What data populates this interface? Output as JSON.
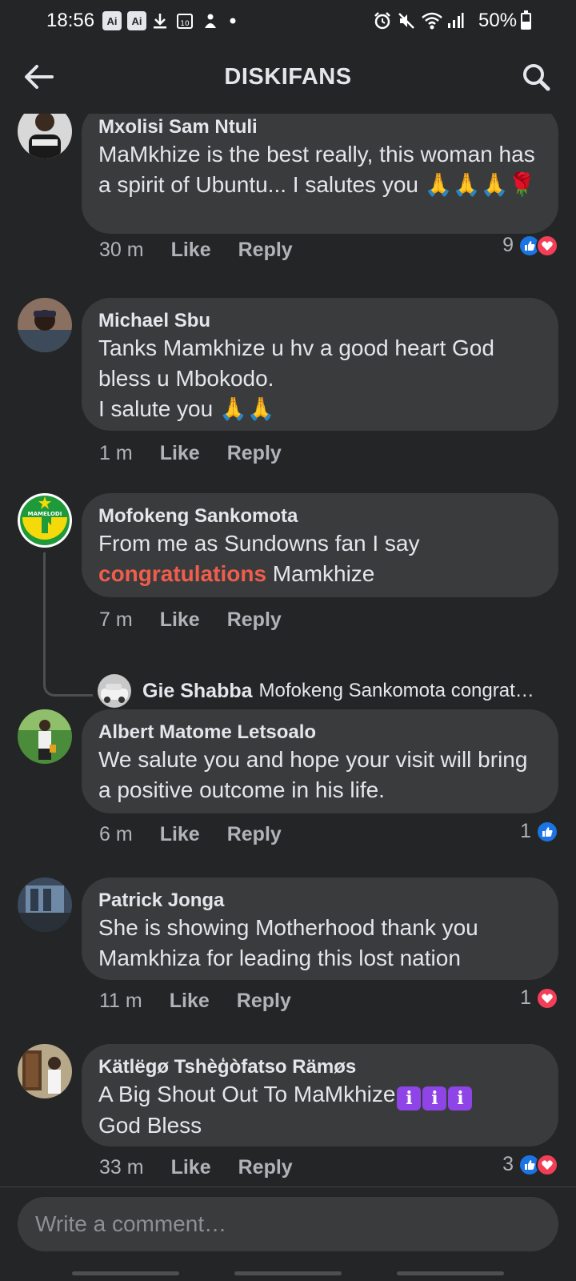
{
  "status_bar": {
    "time": "18:56",
    "icons": [
      "ai-notification-icon",
      "ai-notification-icon",
      "download-icon",
      "calendar-icon",
      "game-icon",
      "dot-icon",
      "alarm-icon",
      "mute-icon",
      "wifi-icon",
      "signal-icon"
    ],
    "ai_label": "Ai",
    "calendar_label": "10",
    "battery_text": "50%",
    "battery_level": 0.5
  },
  "app_bar": {
    "title": "DISKIFANS"
  },
  "comments": [
    {
      "author": "Mxolisi Sam Ntuli",
      "text": "MaMkhize is the best really, this woman has a spirit of Ubuntu... I salutes you 🙏🙏🙏🌹",
      "time": "30 m",
      "like_label": "Like",
      "reply_label": "Reply",
      "reaction_count": "9",
      "reactions": [
        "like",
        "love"
      ]
    },
    {
      "author": "Michael Sbu",
      "text_lines": [
        "Tanks Mamkhize u hv a good heart God bless u Mbokodo.",
        "I salute you 🙏🙏"
      ],
      "time": "1 m",
      "like_label": "Like",
      "reply_label": "Reply"
    },
    {
      "author": "Mofokeng Sankomota",
      "text_before": "From me as Sundowns fan I say",
      "text_highlight": "congratulations",
      "text_after": " Mamkhize",
      "time": "7 m",
      "like_label": "Like",
      "reply_label": "Reply",
      "avatar_label": "MAMELODI",
      "reply_preview": {
        "author": "Gie Shabba",
        "text": "Mofokeng Sankomota  congrat…"
      }
    },
    {
      "author": "Albert Matome Letsoalo",
      "text": "We salute you and hope your visit will bring a positive outcome in his life.",
      "time": "6 m",
      "like_label": "Like",
      "reply_label": "Reply",
      "reaction_count": "1",
      "reactions": [
        "like"
      ]
    },
    {
      "author": "Patrick Jonga",
      "text": "She is showing Motherhood thank you Mamkhiza for leading this lost nation",
      "time": "11 m",
      "like_label": "Like",
      "reply_label": "Reply",
      "reaction_count": "1",
      "reactions": [
        "love"
      ]
    },
    {
      "author": "Kätlëgø Tshèģòfatso Rämøs",
      "text_before": "A Big Shout Out To MaMkhize",
      "info_emoji": "i",
      "text_after": "God Bless",
      "time": "33 m",
      "like_label": "Like",
      "reply_label": "Reply",
      "reaction_count": "3",
      "reactions": [
        "like",
        "love"
      ]
    }
  ],
  "composer": {
    "placeholder": "Write a comment…"
  },
  "colors": {
    "background": "#242526",
    "bubble": "#3a3b3c",
    "text": "#e4e6eb",
    "meta": "#b0b3b8",
    "highlight": "#f05d4d",
    "like_blue": "#1b74e4",
    "love_red": "#f33e58"
  }
}
